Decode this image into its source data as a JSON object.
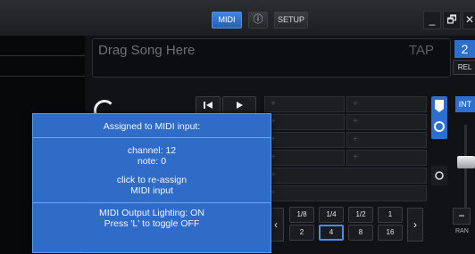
{
  "topbar": {
    "buttons": [
      {
        "label": "MIDI",
        "active": true
      },
      {
        "label": "ⓘ",
        "active": false
      },
      {
        "label": "SETUP",
        "active": false
      }
    ],
    "window": [
      "_",
      "🗗",
      "✕"
    ]
  },
  "deck": {
    "song_placeholder": "Drag Song Here",
    "tap": "TAP",
    "deck_number": "2",
    "rel": "REL",
    "int": "INT",
    "ran": "RAN",
    "minus": "−",
    "prev_icon": "skip-back-icon",
    "play_icon": "play-icon",
    "pads": [
      "+",
      "+",
      "+",
      "+",
      "+",
      "+",
      "+",
      "+",
      "+",
      "+",
      "+",
      "+"
    ],
    "loop_top": [
      "1/8",
      "1/4",
      "1/2",
      "1"
    ],
    "loop_bottom": [
      "2",
      "4",
      "8",
      "16"
    ],
    "loop_selected": "4",
    "nav_left": "‹",
    "nav_right": "›"
  },
  "popup": {
    "heading": "Assigned to MIDI input:",
    "channel": "channel: 12",
    "note": "note: 0",
    "reassign_line1": "click to re-assign",
    "reassign_line2": "MIDI input",
    "lighting_line1": "MIDI Output Lighting: ON",
    "lighting_line2": "Press 'L' to toggle OFF"
  },
  "colors": {
    "accent": "#2d6fcf",
    "popup": "#2f6cc7"
  }
}
